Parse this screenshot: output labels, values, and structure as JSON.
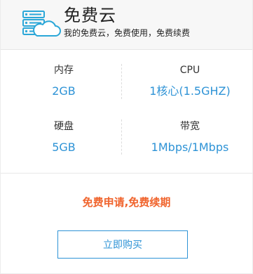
{
  "header": {
    "title": "免费云",
    "subtitle": "我的免费云，免费使用，免费续费",
    "logo_icon": "server-cloud-icon"
  },
  "specs": [
    {
      "label": "内存",
      "value": "2GB"
    },
    {
      "label": "CPU",
      "value": "1核心(1.5GHZ)"
    },
    {
      "label": "硬盘",
      "value": "5GB"
    },
    {
      "label": "带宽",
      "value": "1Mbps/1Mbps"
    }
  ],
  "promo": "免费申请,免费续期",
  "buy_button": "立即购买",
  "colors": {
    "accent": "#2e93d6",
    "promo": "#f0642d",
    "header_bg": "#f7f7f7"
  }
}
